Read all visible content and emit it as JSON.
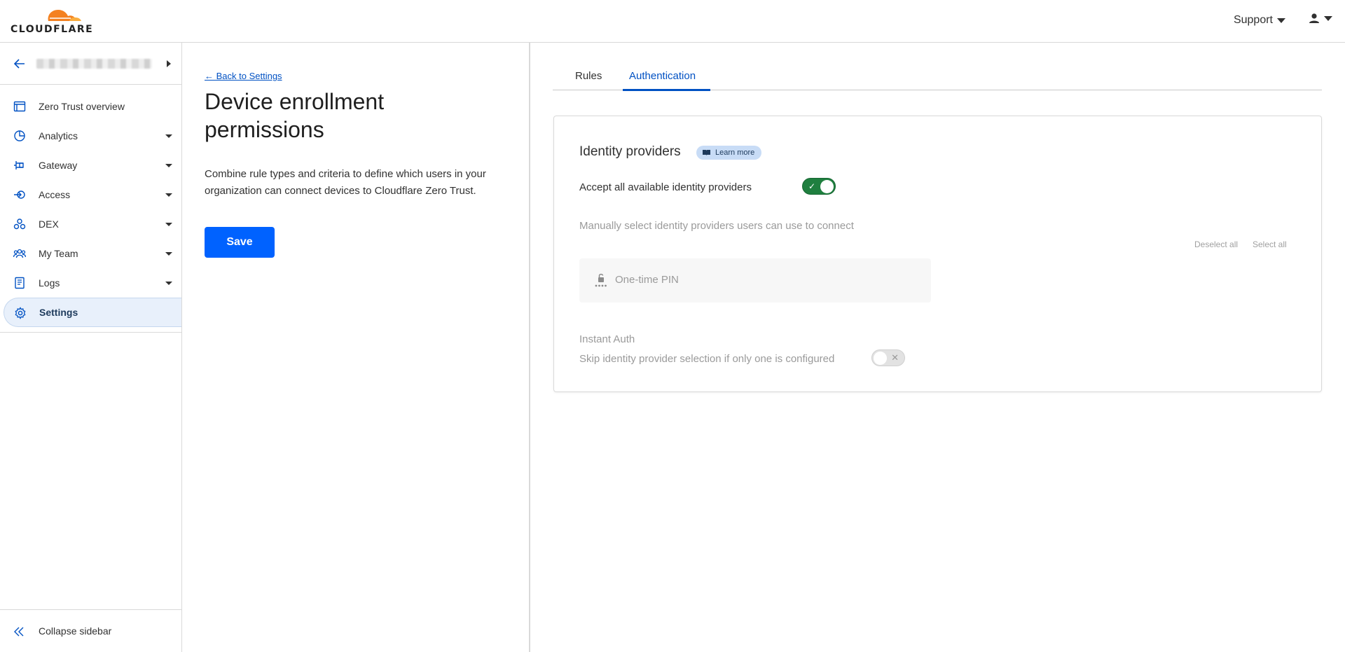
{
  "header": {
    "logo_text": "CLOUDFLARE",
    "support_label": "Support",
    "brand_color": "#f48120"
  },
  "sidebar": {
    "items": [
      {
        "label": "Zero Trust overview",
        "icon": "window-icon",
        "expandable": false
      },
      {
        "label": "Analytics",
        "icon": "pie-chart-icon",
        "expandable": true
      },
      {
        "label": "Gateway",
        "icon": "gateway-icon",
        "expandable": true
      },
      {
        "label": "Access",
        "icon": "access-icon",
        "expandable": true
      },
      {
        "label": "DEX",
        "icon": "dex-icon",
        "expandable": true
      },
      {
        "label": "My Team",
        "icon": "team-icon",
        "expandable": true
      },
      {
        "label": "Logs",
        "icon": "logs-icon",
        "expandable": true
      },
      {
        "label": "Settings",
        "icon": "gear-icon",
        "expandable": false,
        "active": true
      }
    ],
    "collapse_label": "Collapse sidebar"
  },
  "main": {
    "back_link": "← Back to Settings",
    "title": "Device enrollment permissions",
    "description": "Combine rule types and criteria to define which users in your organization can connect devices to Cloudflare Zero Trust.",
    "save_label": "Save",
    "accent_color": "#0062ff"
  },
  "tabs": [
    {
      "label": "Rules",
      "active": false
    },
    {
      "label": "Authentication",
      "active": true
    }
  ],
  "auth": {
    "title": "Identity providers",
    "learn_more": "Learn more",
    "accept_all_label": "Accept all available identity providers",
    "accept_all_enabled": true,
    "manual_label": "Manually select identity providers users can use to connect",
    "deselect_all": "Deselect all",
    "select_all": "Select all",
    "providers": [
      {
        "label": "One-time PIN",
        "icon": "lock-pin-icon"
      }
    ],
    "instant_auth_title": "Instant Auth",
    "instant_auth_desc": "Skip identity provider selection if only one is configured",
    "instant_auth_enabled": false,
    "toggle_on_color": "#1f7f3f"
  }
}
